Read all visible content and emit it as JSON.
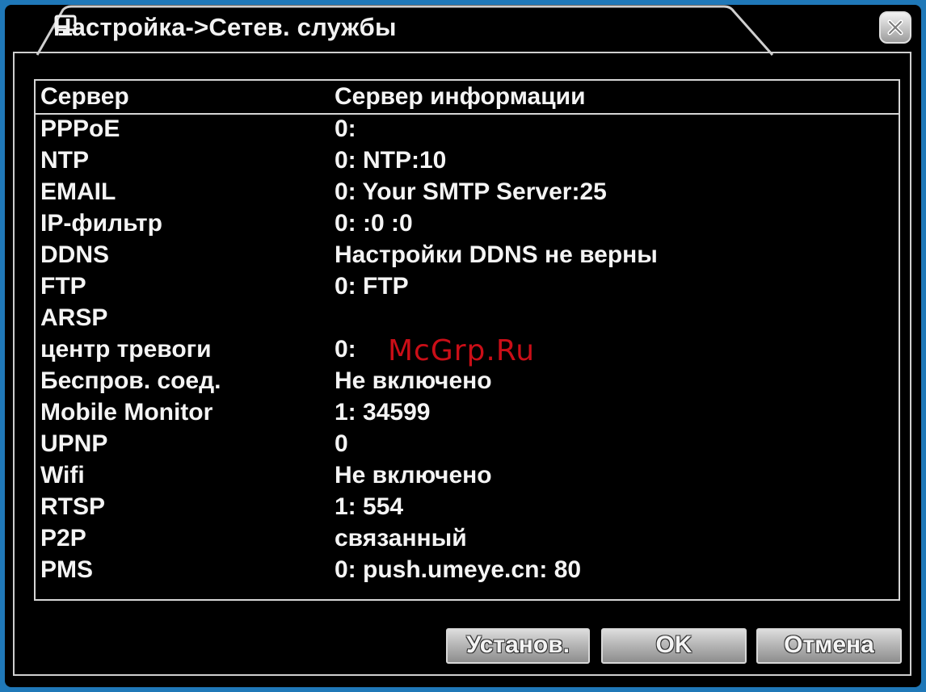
{
  "window": {
    "title": "Настройка->Сетев. службы",
    "title_icon": "monitor-icon",
    "close_icon": "close-icon"
  },
  "table": {
    "headers": {
      "server": "Сервер",
      "info": "Сервер информации"
    },
    "rows": [
      {
        "server": "PPPoE",
        "info": "0:"
      },
      {
        "server": "NTP",
        "info": "0: NTP:10"
      },
      {
        "server": "EMAIL",
        "info": "0: Your SMTP Server:25"
      },
      {
        "server": "IP-фильтр",
        "info": "0: :0 :0"
      },
      {
        "server": "DDNS",
        "info": "Настройки DDNS не верны"
      },
      {
        "server": "FTP",
        "info": "0: FTP"
      },
      {
        "server": "ARSP",
        "info": ""
      },
      {
        "server": "центр тревоги",
        "info": "0:"
      },
      {
        "server": "Беспров. соед.",
        "info": "Не включено"
      },
      {
        "server": "Mobile Monitor",
        "info": "1: 34599"
      },
      {
        "server": "UPNP",
        "info": "0"
      },
      {
        "server": "Wifi",
        "info": "Не включено"
      },
      {
        "server": "RTSP",
        "info": "1: 554"
      },
      {
        "server": "P2P",
        "info": "связанный"
      },
      {
        "server": "PMS",
        "info": "0: push.umeye.cn: 80"
      }
    ]
  },
  "watermark": "McGrp.Ru",
  "buttons": {
    "set": "Установ.",
    "ok": "OK",
    "cancel": "Отмена"
  },
  "colors": {
    "background": "#1f78b8",
    "window": "#000000",
    "text": "#f4f4f4",
    "watermark": "#e0101a"
  }
}
